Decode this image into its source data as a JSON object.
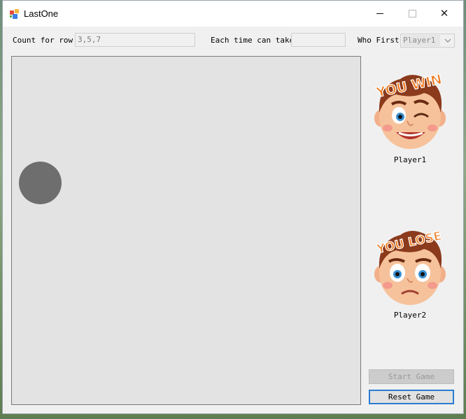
{
  "window": {
    "title": "LastOne",
    "close_glyph": "✕"
  },
  "form": {
    "count_label": "Count for row",
    "count_value": "3,5,7",
    "take_label": "Each time can take",
    "take_value": "",
    "first_label": "Who First",
    "first_value": "Player1"
  },
  "players": [
    {
      "name": "Player1",
      "banner": "YOU WIN",
      "icon": "winning-boy-face-icon"
    },
    {
      "name": "Player2",
      "banner": "YOU LOSE",
      "icon": "losing-boy-face-icon"
    }
  ],
  "buttons": {
    "start": "Start Game",
    "reset": "Reset Game"
  },
  "colors": {
    "piece": "#6e6e6e",
    "board": "#e3e3e3",
    "focus_border": "#2b7cd3",
    "banner_orange": "#f07a1e"
  }
}
